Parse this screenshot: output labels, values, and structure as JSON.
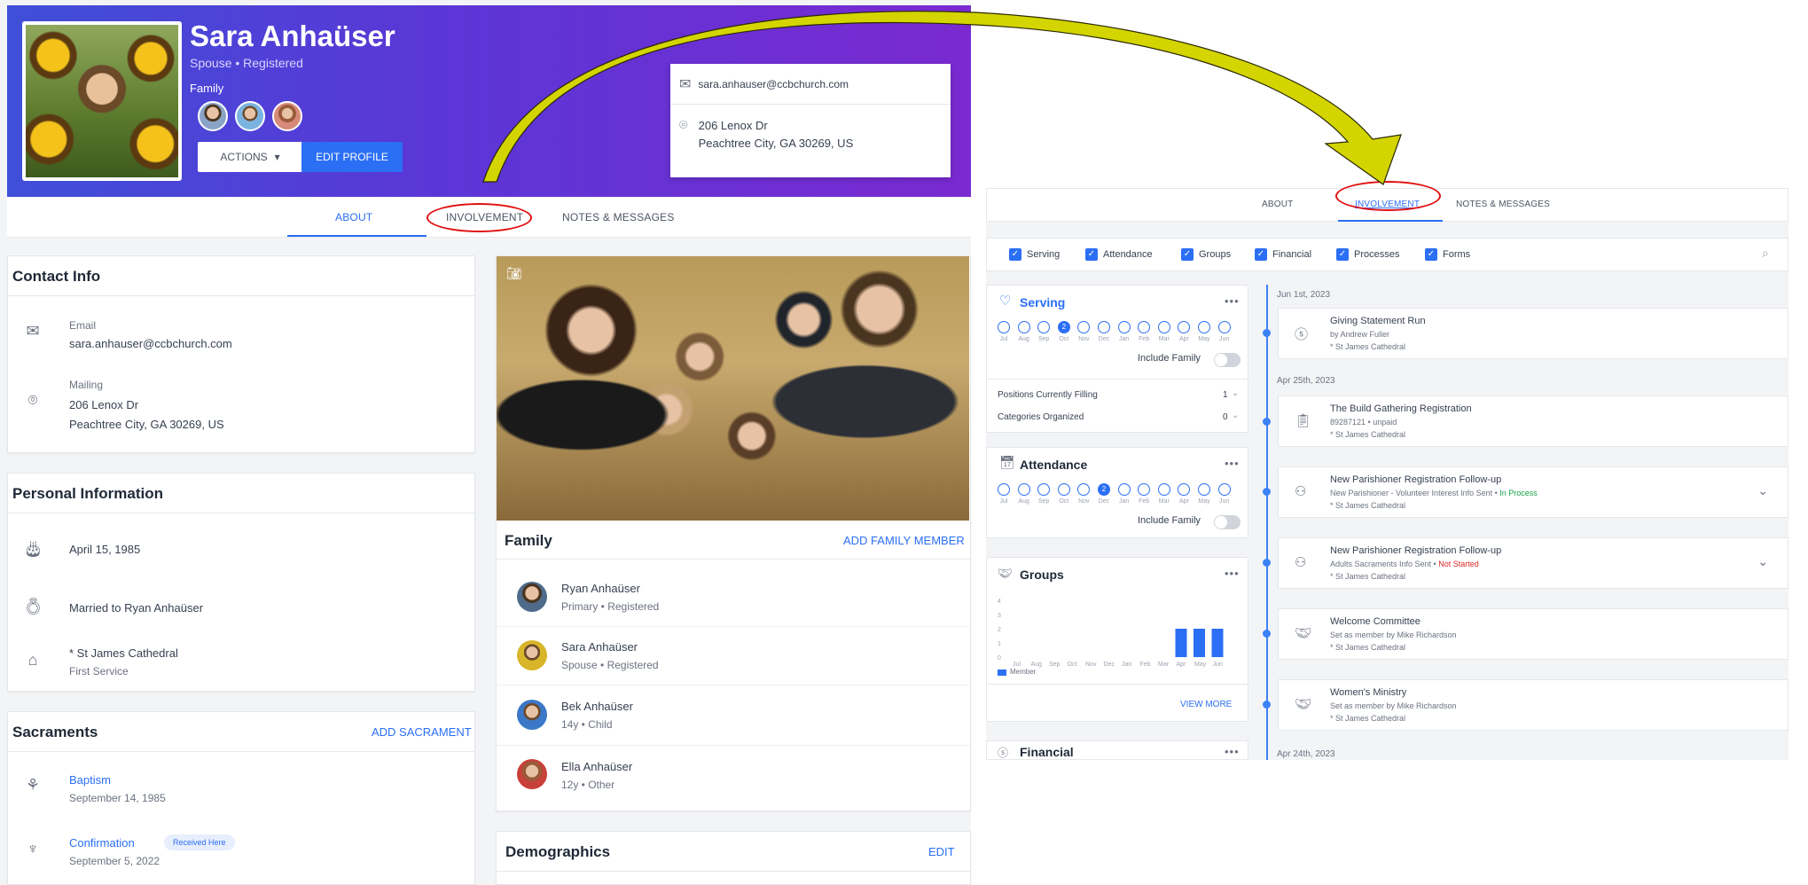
{
  "profile": {
    "name": "Sara Anhaüser",
    "subtitle": "Spouse • Registered",
    "family_label": "Family",
    "actions_label": "ACTIONS",
    "edit_label": "EDIT PROFILE",
    "email": "sara.anhauser@ccbchurch.com",
    "address_line1": "206 Lenox Dr",
    "address_line2": "Peachtree City, GA 30269, US"
  },
  "tabs_left": {
    "about": "ABOUT",
    "involvement": "INVOLVEMENT",
    "notes": "NOTES & MESSAGES"
  },
  "contact_info": {
    "title": "Contact Info",
    "email_label": "Email",
    "email_value": "sara.anhauser@ccbchurch.com",
    "mailing_label": "Mailing",
    "mailing_line1": "206 Lenox Dr",
    "mailing_line2": "Peachtree City, GA 30269, US"
  },
  "personal_info": {
    "title": "Personal Information",
    "birthday": "April 15, 1985",
    "marital": "Married to Ryan Anhaüser",
    "campus": "* St James Cathedral",
    "service": "First Service"
  },
  "sacraments": {
    "title": "Sacraments",
    "add_label": "ADD SACRAMENT",
    "items": [
      {
        "name": "Baptism",
        "date": "September 14, 1985",
        "badge": ""
      },
      {
        "name": "Confirmation",
        "date": "September 5, 2022",
        "badge": "Received Here"
      }
    ]
  },
  "family": {
    "title": "Family",
    "add_label": "ADD FAMILY MEMBER",
    "members": [
      {
        "name": "Ryan Anhaüser",
        "role": "Primary • Registered"
      },
      {
        "name": "Sara Anhaüser",
        "role": "Spouse • Registered"
      },
      {
        "name": "Bek Anhaüser",
        "role": "14y • Child"
      },
      {
        "name": "Ella Anhaüser",
        "role": "12y • Other"
      }
    ]
  },
  "demographics": {
    "title": "Demographics",
    "edit_label": "EDIT"
  },
  "tabs_right": {
    "about": "ABOUT",
    "involvement": "INVOLVEMENT",
    "notes": "NOTES & MESSAGES"
  },
  "filters": [
    "Serving",
    "Attendance",
    "Groups",
    "Financial",
    "Processes",
    "Forms"
  ],
  "months": [
    "Jul",
    "Aug",
    "Sep",
    "Oct",
    "Nov",
    "Dec",
    "Jan",
    "Feb",
    "Mar",
    "Apr",
    "May",
    "Jun"
  ],
  "serving": {
    "title": "Serving",
    "marker": "2",
    "include_family": "Include Family",
    "positions_label": "Positions Currently Filling",
    "positions_value": "1",
    "categories_label": "Categories Organized",
    "categories_value": "0"
  },
  "attendance": {
    "title": "Attendance",
    "marker": "2",
    "include_family": "Include Family"
  },
  "groups": {
    "title": "Groups",
    "y_ticks": [
      "4",
      "3",
      "2",
      "1",
      "0"
    ],
    "legend": "Member",
    "view_more": "VIEW MORE",
    "bars": [
      0,
      0,
      0,
      0,
      0,
      0,
      0,
      0,
      0,
      2,
      2,
      2
    ]
  },
  "financial": {
    "title": "Financial"
  },
  "timeline": {
    "dates": [
      "Jun 1st, 2023",
      "Apr 25th, 2023",
      "Apr 24th, 2023"
    ],
    "entries": [
      {
        "title": "Giving Statement Run",
        "line2": "by Andrew Fuller",
        "line3": "* St James Cathedral"
      },
      {
        "title": "The Build Gathering Registration",
        "line2": "89287121 • unpaid",
        "line3": "* St James Cathedral"
      },
      {
        "title": "New Parishioner Registration Follow-up",
        "line2": "New Parishioner - Volunteer Interest Info Sent • ",
        "status": "In Process",
        "line3": "* St James Cathedral"
      },
      {
        "title": "New Parishioner Registration Follow-up",
        "line2": "Adults Sacraments Info Sent • ",
        "status": "Not Started",
        "line3": "* St James Cathedral"
      },
      {
        "title": "Welcome Committee",
        "line2": "Set as member by Mike Richardson",
        "line3": "* St James Cathedral"
      },
      {
        "title": "Women's Ministry",
        "line2": "Set as member by Mike Richardson",
        "line3": "* St James Cathedral"
      }
    ]
  },
  "colors": {
    "accent": "#2b6ff5",
    "hero_start": "#3f4fd8",
    "hero_end": "#7a2ad0",
    "arrow": "#d4d400",
    "highlight": "#e01010"
  }
}
